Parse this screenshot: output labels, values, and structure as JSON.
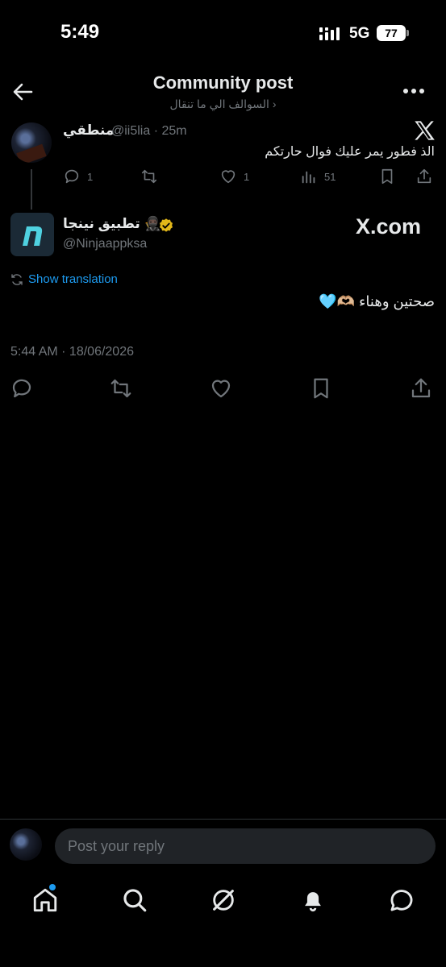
{
  "status_bar": {
    "time": "5:49",
    "network": "5G",
    "battery": "77"
  },
  "header": {
    "title": "Community post",
    "subtitle": "السوالف الي ما تنقال ›"
  },
  "quoted_post": {
    "name": "منطقي",
    "handle": "@ii5lia · 25m",
    "text": "الذ فطور يمر عليك فوال حارتكم",
    "replies": "1",
    "likes": "1",
    "views": "51"
  },
  "main_post": {
    "name": "تطبيق نينجا 🥷🏿",
    "handle": "@Ninjaappksa",
    "overlay_text": "X.com",
    "translate_label": "Show translation",
    "text": "صحتين وهناء 🫶🏼🩵",
    "timestamp": "5:44 AM · 18/06/2026"
  },
  "reply_bar": {
    "placeholder": "Post your reply"
  },
  "bottom_nav": [
    "home-icon",
    "search-icon",
    "grok-icon",
    "bell-icon",
    "messages-icon"
  ],
  "colors": {
    "accent": "#1d9bf0",
    "muted": "#71767b",
    "background": "#000000",
    "verified": "#e2b719"
  }
}
